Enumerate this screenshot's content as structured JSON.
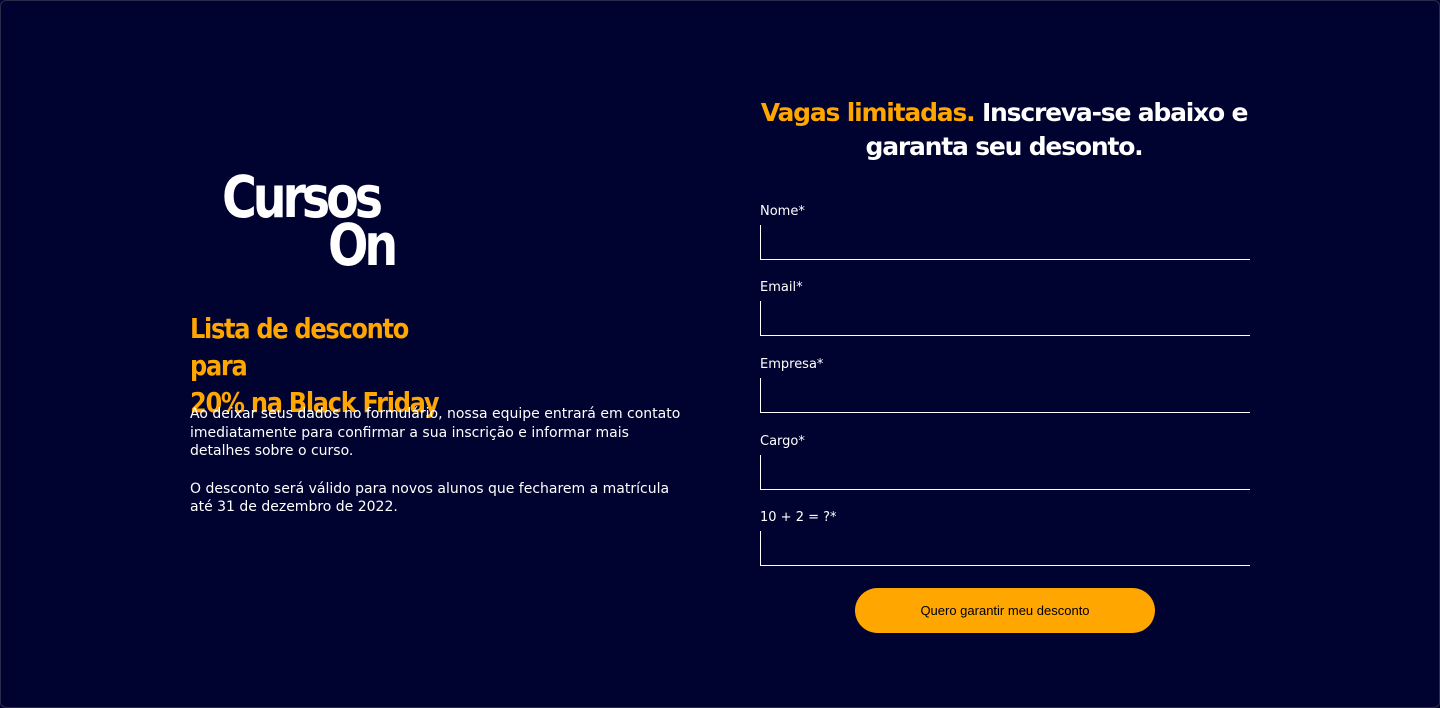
{
  "brand": {
    "logo_line1": "Cursos",
    "logo_line2": "On"
  },
  "left": {
    "headline_line1": "Lista de desconto para",
    "headline_line2": "20% na Black Friday",
    "paragraph1": "Ao deixar seus dados no formulário, nossa equipe entrará em contato imediatamente para confirmar a sua inscrição e informar mais detalhes sobre o curso.",
    "paragraph2": "O desconto será válido para novos alunos que fecharem a matrícula até 31 de dezembro de 2022."
  },
  "form": {
    "title_accent": "Vagas limitadas.",
    "title_rest": " Inscreva-se abaixo e garanta seu desonto.",
    "fields": [
      {
        "label": "Nome*",
        "value": ""
      },
      {
        "label": "Email*",
        "value": ""
      },
      {
        "label": "Empresa*",
        "value": ""
      },
      {
        "label": "Cargo*",
        "value": ""
      },
      {
        "label": "10 + 2 = ?*",
        "value": ""
      }
    ],
    "submit_label": "Quero garantir meu desconto"
  },
  "colors": {
    "background": "#000230",
    "accent": "#ffa600",
    "text": "#ffffff"
  }
}
